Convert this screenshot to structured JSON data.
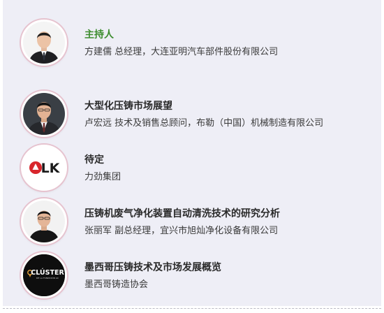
{
  "speakers": [
    {
      "title": "主持人",
      "subtitle": "方建儒  总经理，大连亚明汽车部件股份有限公司"
    },
    {
      "title": "大型化压铸市场展望",
      "subtitle": "卢宏远 技术及销售总顾问，布勒（中国）机械制造有限公司"
    },
    {
      "title": "待定",
      "subtitle": "力劲集团"
    },
    {
      "title": "压铸机废气净化装置自动清洗技术的研究分析",
      "subtitle": "张丽军 副总经理，宜兴市旭灿净化设备有限公司"
    },
    {
      "title": "墨西哥压铸技术及市场发展概览",
      "subtitle": "墨西哥铸造协会"
    }
  ],
  "logos": {
    "lk_text": "LK",
    "cluster_text": "CLÚSTER",
    "cluster_subtext": "DE LA FUNDICIÓN AC"
  },
  "colors": {
    "host_title": "#3d8c2f",
    "panel_bg": "#eeeef6",
    "lk_red": "#d8262c"
  }
}
